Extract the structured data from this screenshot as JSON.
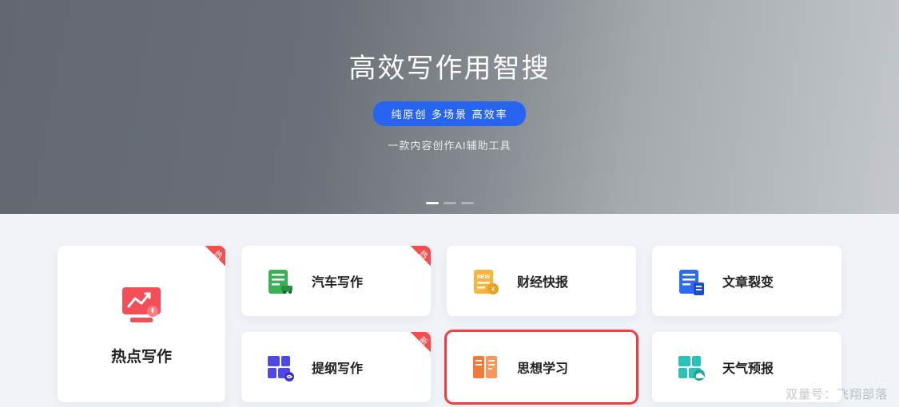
{
  "hero": {
    "title": "高效写作用智搜",
    "pill": "纯原创 多场景 高效率",
    "subtitle": "一款内容创作AI辅助工具"
  },
  "featured": {
    "label": "热点写作",
    "ribbon": "热"
  },
  "cards": [
    {
      "label": "汽车写作",
      "ribbon": "热",
      "selected": false,
      "icon": "car-doc",
      "color": "#3bb155"
    },
    {
      "label": "财经快报",
      "ribbon": "",
      "selected": false,
      "icon": "finance",
      "color": "#f7b53c"
    },
    {
      "label": "文章裂变",
      "ribbon": "",
      "selected": false,
      "icon": "split",
      "color": "#2f6af2"
    },
    {
      "label": "提纲写作",
      "ribbon": "新",
      "selected": false,
      "icon": "outline",
      "color": "#5048e5"
    },
    {
      "label": "思想学习",
      "ribbon": "",
      "selected": true,
      "icon": "study",
      "color": "#f27a3b"
    },
    {
      "label": "天气预报",
      "ribbon": "",
      "selected": false,
      "icon": "weather",
      "color": "#2ac2b9"
    }
  ],
  "watermark": "双量号：飞翔部落"
}
